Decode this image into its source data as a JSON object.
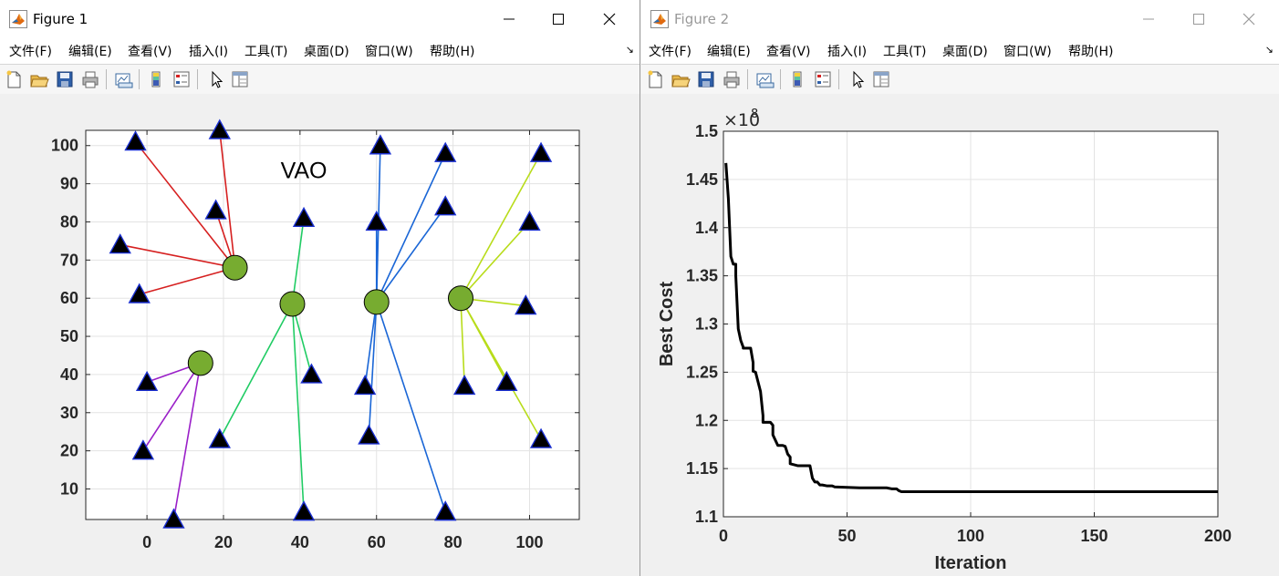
{
  "windows": [
    {
      "title": "Figure 1",
      "active": true,
      "menu": [
        "文件(F)",
        "编辑(E)",
        "查看(V)",
        "插入(I)",
        "工具(T)",
        "桌面(D)",
        "窗口(W)",
        "帮助(H)"
      ],
      "toolbar_icons": [
        "new-file-icon",
        "open-folder-icon",
        "save-icon",
        "print-icon",
        "link-plot-icon",
        "colorbar-icon",
        "legend-icon",
        "pointer-icon",
        "property-editor-icon"
      ]
    },
    {
      "title": "Figure 2",
      "active": false,
      "menu": [
        "文件(F)",
        "编辑(E)",
        "查看(V)",
        "插入(I)",
        "工具(T)",
        "桌面(D)",
        "窗口(W)",
        "帮助(H)"
      ],
      "toolbar_icons": [
        "new-file-icon",
        "open-folder-icon",
        "save-icon",
        "print-icon",
        "link-plot-icon",
        "colorbar-icon",
        "legend-icon",
        "pointer-icon",
        "property-editor-icon"
      ]
    }
  ],
  "chart_data": [
    {
      "type": "scatter",
      "title": "VAO",
      "xlabel": "",
      "ylabel": "",
      "xlim": [
        -16,
        113
      ],
      "ylim": [
        2,
        104
      ],
      "xticks": [
        0,
        20,
        40,
        60,
        80,
        100
      ],
      "yticks": [
        10,
        20,
        30,
        40,
        50,
        60,
        70,
        80,
        90,
        100
      ],
      "grid": true,
      "clusters": [
        {
          "color": "#d62020",
          "center": [
            23,
            68
          ],
          "targets": [
            [
              -3,
              101
            ],
            [
              19,
              104
            ],
            [
              18,
              83
            ],
            [
              -7,
              74
            ],
            [
              -2,
              61
            ]
          ]
        },
        {
          "color": "#9a1fc8",
          "center": [
            14,
            43
          ],
          "targets": [
            [
              0,
              38
            ],
            [
              -1,
              20
            ],
            [
              7,
              2
            ]
          ]
        },
        {
          "color": "#20cc64",
          "center": [
            38,
            58.5
          ],
          "targets": [
            [
              41,
              81
            ],
            [
              19,
              23
            ],
            [
              43,
              40
            ],
            [
              41,
              4
            ]
          ]
        },
        {
          "color": "#1a66d6",
          "center": [
            60,
            59
          ],
          "targets": [
            [
              61,
              100
            ],
            [
              60,
              80
            ],
            [
              78,
              98
            ],
            [
              78,
              84
            ],
            [
              57,
              37
            ],
            [
              58,
              24
            ],
            [
              78,
              4
            ]
          ]
        },
        {
          "color": "#b8dc1a",
          "center": [
            82,
            60
          ],
          "targets": [
            [
              103,
              98
            ],
            [
              100,
              80
            ],
            [
              99,
              58
            ],
            [
              94,
              38
            ],
            [
              83,
              37
            ],
            [
              103,
              23
            ]
          ]
        }
      ]
    },
    {
      "type": "line",
      "title": "",
      "xlabel": "Iteration",
      "ylabel": "Best Cost",
      "exponent_label": "×10",
      "exponent": "8",
      "xlim": [
        0,
        200
      ],
      "ylim": [
        1.1,
        1.5
      ],
      "xticks": [
        0,
        50,
        100,
        150,
        200
      ],
      "yticks": [
        "1.1",
        "1.15",
        "1.2",
        "1.25",
        "1.3",
        "1.35",
        "1.4",
        "1.45",
        "1.5"
      ],
      "grid": true,
      "series": [
        {
          "color": "#000000",
          "x": [
            1,
            2,
            3,
            4,
            5,
            5,
            6,
            7,
            8,
            8,
            11,
            12,
            12,
            13,
            14,
            15,
            16,
            16,
            19,
            20,
            20,
            22,
            24,
            25,
            26,
            27,
            27,
            30,
            35,
            36,
            37,
            38,
            39,
            40,
            42,
            44,
            45,
            55,
            65,
            66,
            68,
            70,
            71,
            72,
            80,
            100,
            150,
            200
          ],
          "y": [
            1.467,
            1.43,
            1.37,
            1.362,
            1.362,
            1.35,
            1.295,
            1.283,
            1.276,
            1.275,
            1.275,
            1.26,
            1.251,
            1.25,
            1.24,
            1.23,
            1.205,
            1.198,
            1.198,
            1.195,
            1.185,
            1.174,
            1.174,
            1.173,
            1.165,
            1.162,
            1.155,
            1.153,
            1.153,
            1.14,
            1.136,
            1.136,
            1.133,
            1.133,
            1.132,
            1.132,
            1.131,
            1.13,
            1.13,
            1.13,
            1.129,
            1.129,
            1.127,
            1.126,
            1.126,
            1.126,
            1.126,
            1.126
          ]
        }
      ]
    }
  ]
}
